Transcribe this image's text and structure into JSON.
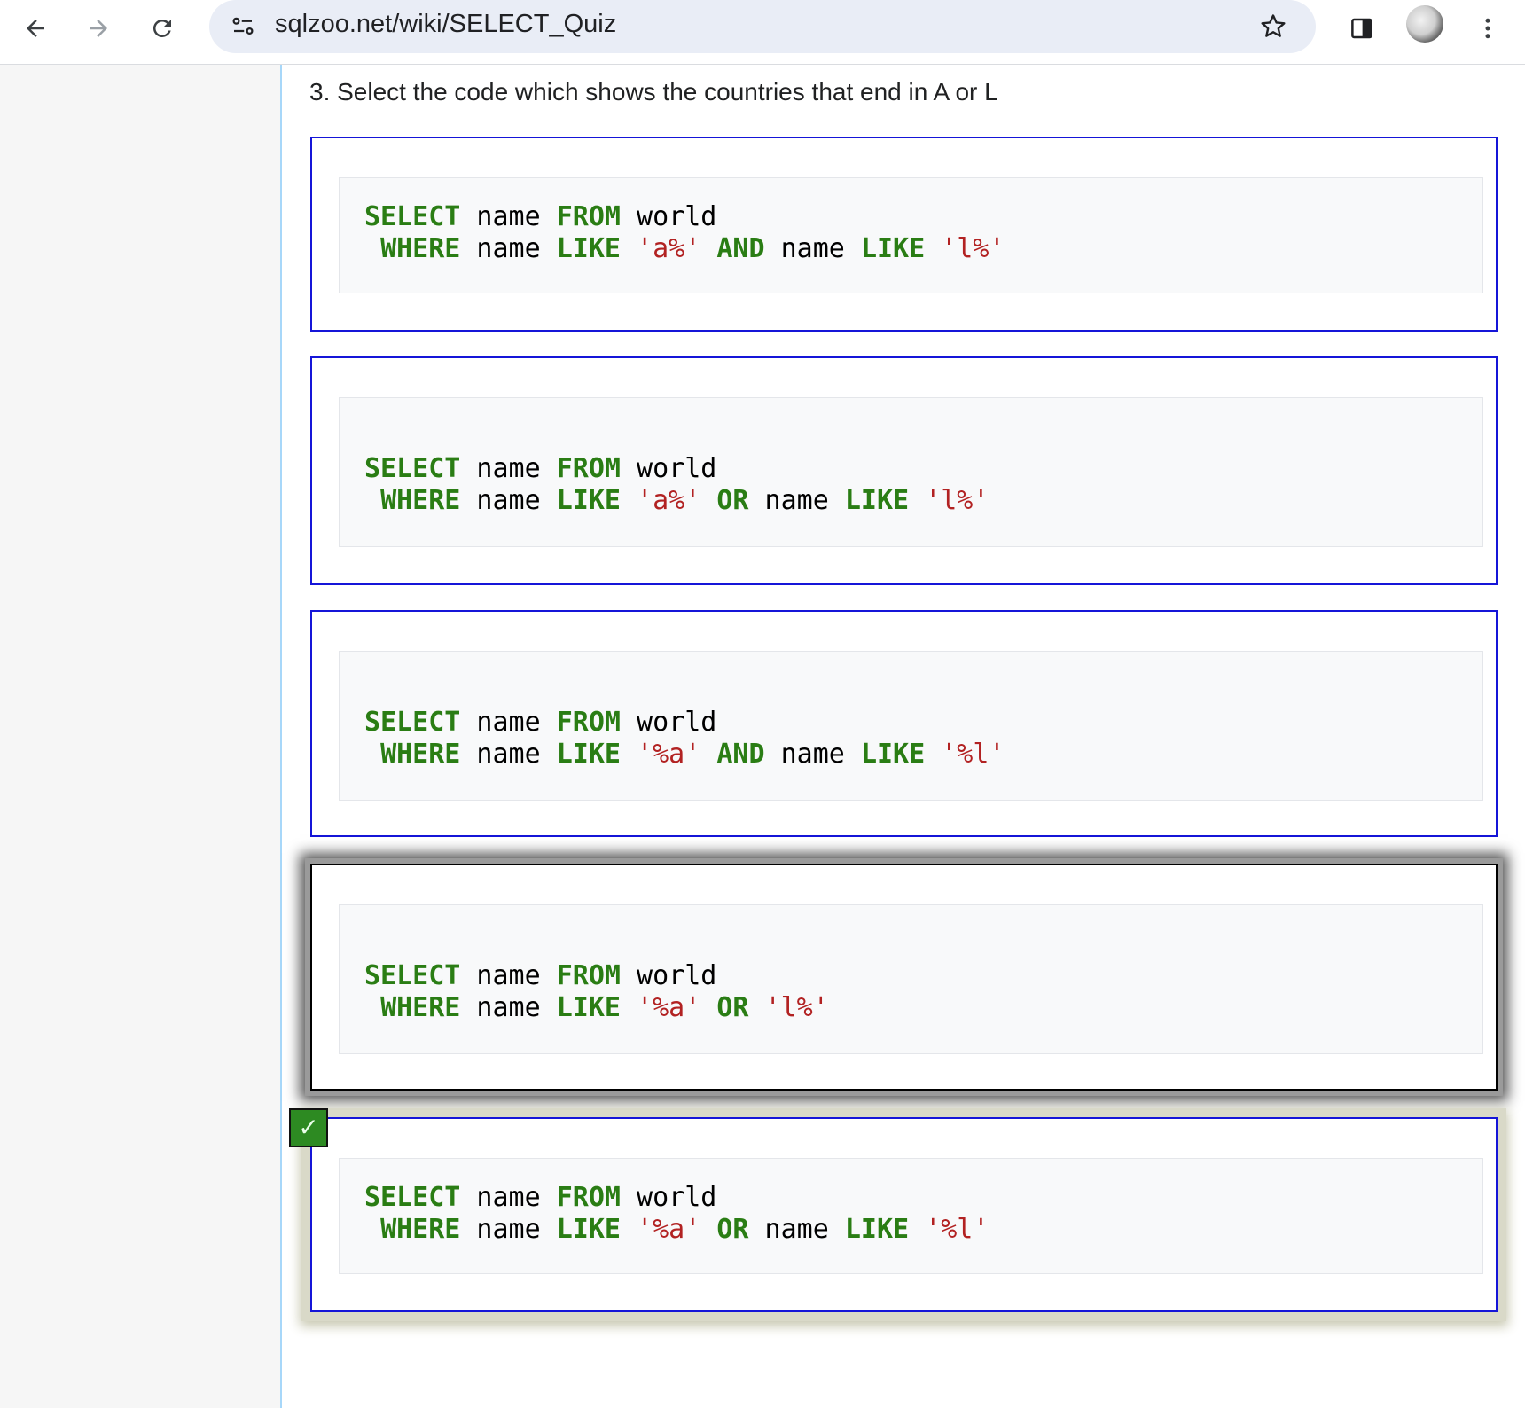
{
  "browser": {
    "url": "sqlzoo.net/wiki/SELECT_Quiz",
    "icons": {
      "back": "arrow-left-icon",
      "forward": "arrow-right-icon",
      "reload": "reload-icon",
      "site_info": "tune-icon",
      "bookmark": "star-icon",
      "side_panel": "side-panel-icon",
      "menu": "kebab-menu-icon"
    }
  },
  "quiz": {
    "question": "3. Select the code which shows the countries that end in A or L",
    "check_mark": "✓",
    "options": [
      {
        "line1": [
          [
            "kw",
            "SELECT"
          ],
          [
            "t",
            " name "
          ],
          [
            "kw",
            "FROM"
          ],
          [
            "t",
            " world"
          ]
        ],
        "line2": [
          [
            "t",
            " "
          ],
          [
            "kw",
            "WHERE"
          ],
          [
            "t",
            " name "
          ],
          [
            "kw",
            "LIKE"
          ],
          [
            "t",
            " "
          ],
          [
            "str",
            "'a%'"
          ],
          [
            "t",
            " "
          ],
          [
            "kw",
            "AND"
          ],
          [
            "t",
            " name "
          ],
          [
            "kw",
            "LIKE"
          ],
          [
            "t",
            " "
          ],
          [
            "str",
            "'l%'"
          ]
        ]
      },
      {
        "line1": [
          [
            "kw",
            "SELECT"
          ],
          [
            "t",
            " name "
          ],
          [
            "kw",
            "FROM"
          ],
          [
            "t",
            " world"
          ]
        ],
        "line2": [
          [
            "t",
            " "
          ],
          [
            "kw",
            "WHERE"
          ],
          [
            "t",
            " name "
          ],
          [
            "kw",
            "LIKE"
          ],
          [
            "t",
            " "
          ],
          [
            "str",
            "'a%'"
          ],
          [
            "t",
            " "
          ],
          [
            "kw",
            "OR"
          ],
          [
            "t",
            " name "
          ],
          [
            "kw",
            "LIKE"
          ],
          [
            "t",
            " "
          ],
          [
            "str",
            "'l%'"
          ]
        ]
      },
      {
        "line1": [
          [
            "kw",
            "SELECT"
          ],
          [
            "t",
            " name "
          ],
          [
            "kw",
            "FROM"
          ],
          [
            "t",
            " world"
          ]
        ],
        "line2": [
          [
            "t",
            " "
          ],
          [
            "kw",
            "WHERE"
          ],
          [
            "t",
            " name "
          ],
          [
            "kw",
            "LIKE"
          ],
          [
            "t",
            " "
          ],
          [
            "str",
            "'%a'"
          ],
          [
            "t",
            " "
          ],
          [
            "kw",
            "AND"
          ],
          [
            "t",
            " name "
          ],
          [
            "kw",
            "LIKE"
          ],
          [
            "t",
            " "
          ],
          [
            "str",
            "'%l'"
          ]
        ]
      },
      {
        "line1": [
          [
            "kw",
            "SELECT"
          ],
          [
            "t",
            " name "
          ],
          [
            "kw",
            "FROM"
          ],
          [
            "t",
            " world"
          ]
        ],
        "line2": [
          [
            "t",
            " "
          ],
          [
            "kw",
            "WHERE"
          ],
          [
            "t",
            " name "
          ],
          [
            "kw",
            "LIKE"
          ],
          [
            "t",
            " "
          ],
          [
            "str",
            "'%a'"
          ],
          [
            "t",
            " "
          ],
          [
            "kw",
            "OR"
          ],
          [
            "t",
            " "
          ],
          [
            "str",
            "'l%'"
          ]
        ]
      },
      {
        "line1": [
          [
            "kw",
            "SELECT"
          ],
          [
            "t",
            " name "
          ],
          [
            "kw",
            "FROM"
          ],
          [
            "t",
            " world"
          ]
        ],
        "line2": [
          [
            "t",
            " "
          ],
          [
            "kw",
            "WHERE"
          ],
          [
            "t",
            " name "
          ],
          [
            "kw",
            "LIKE"
          ],
          [
            "t",
            " "
          ],
          [
            "str",
            "'%a'"
          ],
          [
            "t",
            " "
          ],
          [
            "kw",
            "OR"
          ],
          [
            "t",
            " name "
          ],
          [
            "kw",
            "LIKE"
          ],
          [
            "t",
            " "
          ],
          [
            "str",
            "'%l'"
          ]
        ]
      }
    ],
    "selected_option": 4,
    "correct_option": 5,
    "colors": {
      "option_border": "#1515d8",
      "keyword": "#2a7d14",
      "string": "#b22222",
      "check_badge": "#2d8a22"
    }
  }
}
